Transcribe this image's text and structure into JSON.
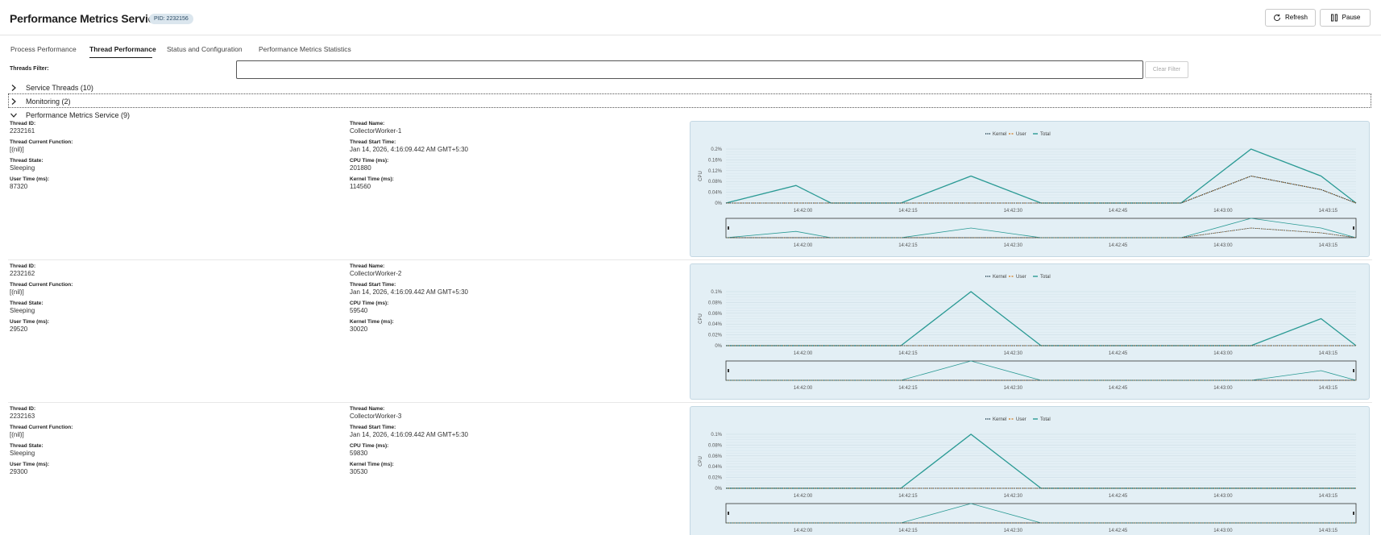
{
  "app": {
    "title": "Performance Metrics Service",
    "pid_badge": "PID: 2232156",
    "refresh_label": "Refresh",
    "pause_label": "Pause"
  },
  "tabs": [
    {
      "label": "Process Performance",
      "active": false
    },
    {
      "label": "Thread Performance",
      "active": true
    },
    {
      "label": "Status and Configuration",
      "active": false
    },
    {
      "label": "Performance Metrics Statistics",
      "active": false
    }
  ],
  "filter": {
    "label": "Threads Filter:",
    "value": "",
    "placeholder": "",
    "clear_label": "Clear Filter"
  },
  "groups": [
    {
      "label": "Service Threads (10)",
      "expanded": false
    },
    {
      "label": "Monitoring (2)",
      "expanded": false
    },
    {
      "label": "Performance Metrics Service (9)",
      "expanded": true
    }
  ],
  "field_labels": {
    "thread_id": "Thread ID:",
    "thread_name": "Thread Name:",
    "current_function": "Thread Current Function:",
    "start_time": "Thread Start Time:",
    "state": "Thread State:",
    "cpu_time": "CPU Time (ms):",
    "user_time": "User Time (ms):",
    "kernel_time": "Kernel Time (ms):"
  },
  "threads": [
    {
      "id": "2232161",
      "name": "CollectorWorker-1",
      "function": "[(nil)]",
      "start_time": "Jan 14, 2026, 4:16:09.442 AM GMT+5:30",
      "state": "Sleeping",
      "cpu_time": "201880",
      "user_time": "87320",
      "kernel_time": "114560"
    },
    {
      "id": "2232162",
      "name": "CollectorWorker-2",
      "function": "[(nil)]",
      "start_time": "Jan 14, 2026, 4:16:09.442 AM GMT+5:30",
      "state": "Sleeping",
      "cpu_time": "59540",
      "user_time": "29520",
      "kernel_time": "30020"
    },
    {
      "id": "2232163",
      "name": "CollectorWorker-3",
      "function": "[(nil)]",
      "start_time": "Jan 14, 2026, 4:16:09.442 AM GMT+5:30",
      "state": "Sleeping",
      "cpu_time": "59830",
      "user_time": "29300",
      "kernel_time": "30530"
    }
  ],
  "chart_data": [
    {
      "type": "line",
      "ylabel": "CPU",
      "legend": [
        "Kernel",
        "User",
        "Total"
      ],
      "legend_placement": "top-center",
      "x": [
        "14:41:49",
        "14:41:59",
        "14:42:04",
        "14:42:14",
        "14:42:24",
        "14:42:34",
        "14:42:44",
        "14:42:54",
        "14:43:04",
        "14:43:14",
        "14:43:19"
      ],
      "x_ticks": [
        "14:42:00",
        "14:42:15",
        "14:42:30",
        "14:42:45",
        "14:43:00",
        "14:43:15"
      ],
      "y_ticks": [
        "0%",
        "0.04%",
        "0.08%",
        "0.12%",
        "0.16%",
        "0.2%"
      ],
      "ylim": [
        0,
        0.2
      ],
      "series": [
        {
          "name": "Kernel",
          "values": [
            0,
            0,
            0,
            0,
            0,
            0,
            0,
            0,
            0.1,
            0.05,
            0
          ]
        },
        {
          "name": "User",
          "values": [
            0,
            0,
            0,
            0,
            0,
            0,
            0,
            0,
            0.1,
            0.05,
            0
          ]
        },
        {
          "name": "Total",
          "values": [
            0,
            0.065,
            0,
            0,
            0.1,
            0,
            0,
            0,
            0.2,
            0.1,
            0
          ]
        }
      ]
    },
    {
      "type": "line",
      "ylabel": "CPU",
      "legend": [
        "Kernel",
        "User",
        "Total"
      ],
      "legend_placement": "top-center",
      "x": [
        "14:41:49",
        "14:41:59",
        "14:42:04",
        "14:42:14",
        "14:42:24",
        "14:42:34",
        "14:42:44",
        "14:42:54",
        "14:43:04",
        "14:43:14",
        "14:43:19"
      ],
      "x_ticks": [
        "14:42:00",
        "14:42:15",
        "14:42:30",
        "14:42:45",
        "14:43:00",
        "14:43:15"
      ],
      "y_ticks": [
        "0%",
        "0.02%",
        "0.04%",
        "0.06%",
        "0.08%",
        "0.1%"
      ],
      "ylim": [
        0,
        0.1
      ],
      "series": [
        {
          "name": "Kernel",
          "values": [
            0,
            0,
            0,
            0,
            0,
            0,
            0,
            0,
            0,
            0,
            0
          ]
        },
        {
          "name": "User",
          "values": [
            0,
            0,
            0,
            0,
            0,
            0,
            0,
            0,
            0,
            0,
            0
          ]
        },
        {
          "name": "Total",
          "values": [
            0,
            0,
            0,
            0,
            0.1,
            0,
            0,
            0,
            0,
            0.05,
            0
          ]
        }
      ]
    },
    {
      "type": "line",
      "ylabel": "CPU",
      "legend": [
        "Kernel",
        "User",
        "Total"
      ],
      "legend_placement": "top-center",
      "x": [
        "14:41:49",
        "14:41:59",
        "14:42:04",
        "14:42:14",
        "14:42:24",
        "14:42:34",
        "14:42:44",
        "14:42:54",
        "14:43:04",
        "14:43:14",
        "14:43:19"
      ],
      "x_ticks": [
        "14:42:00",
        "14:42:15",
        "14:42:30",
        "14:42:45",
        "14:43:00",
        "14:43:15"
      ],
      "y_ticks": [
        "0%",
        "0.02%",
        "0.04%",
        "0.06%",
        "0.08%",
        "0.1%"
      ],
      "ylim": [
        0,
        0.1
      ],
      "series": [
        {
          "name": "Kernel",
          "values": [
            0,
            0,
            0,
            0,
            0,
            0,
            0,
            0,
            0,
            0,
            0
          ]
        },
        {
          "name": "User",
          "values": [
            0,
            0,
            0,
            0,
            0,
            0,
            0,
            0,
            0,
            0,
            0
          ]
        },
        {
          "name": "Total",
          "values": [
            0,
            0,
            0,
            0,
            0.1,
            0,
            0,
            0,
            0,
            0,
            0
          ]
        }
      ]
    }
  ],
  "colors": {
    "kernel": "#1a3a4a",
    "user": "#d58a3a",
    "total": "#2a9a94",
    "chart_bg": "#e3eff5"
  }
}
